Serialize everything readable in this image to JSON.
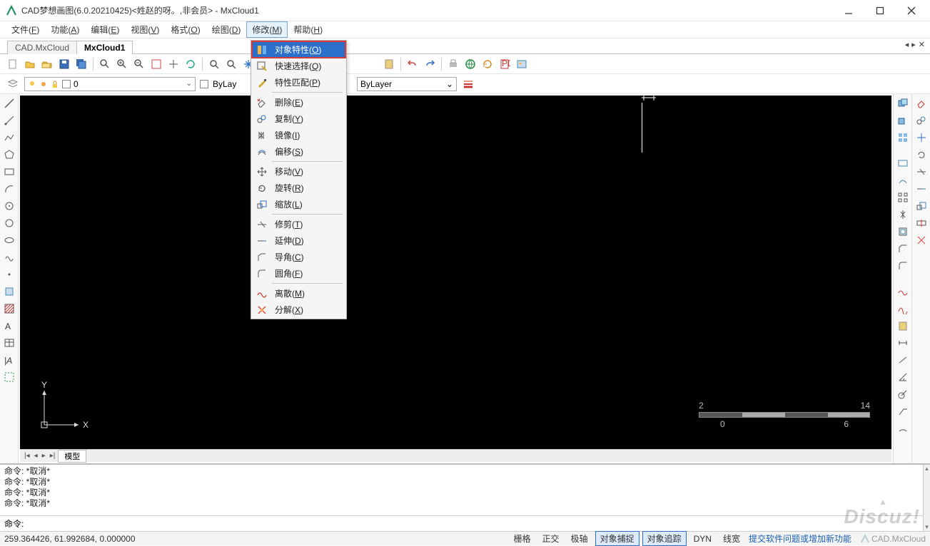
{
  "window": {
    "title": "CAD梦想画图(6.0.20210425)<姓赵的呀。,非会员> - MxCloud1"
  },
  "menubar": {
    "items": [
      {
        "label": "文件",
        "accel": "F"
      },
      {
        "label": "功能",
        "accel": "A"
      },
      {
        "label": "编辑",
        "accel": "E"
      },
      {
        "label": "视图",
        "accel": "V"
      },
      {
        "label": "格式",
        "accel": "O"
      },
      {
        "label": "绘图",
        "accel": "D"
      },
      {
        "label": "修改",
        "accel": "M",
        "open": true
      },
      {
        "label": "帮助",
        "accel": "H"
      }
    ]
  },
  "tabs": {
    "items": [
      {
        "label": "CAD.MxCloud",
        "active": false
      },
      {
        "label": "MxCloud1",
        "active": true
      }
    ]
  },
  "dropdown": {
    "items": [
      {
        "label": "对象特性",
        "accel": "O",
        "highlight": true,
        "icon": "properties-icon"
      },
      {
        "label": "快速选择",
        "accel": "Q",
        "icon": "quick-select-icon"
      },
      {
        "label": "特性匹配",
        "accel": "P",
        "icon": "match-props-icon"
      },
      {
        "sep": true
      },
      {
        "label": "删除",
        "accel": "E",
        "icon": "erase-icon"
      },
      {
        "label": "复制",
        "accel": "Y",
        "icon": "copy-icon"
      },
      {
        "label": "镜像",
        "accel": "I",
        "icon": "mirror-icon"
      },
      {
        "label": "偏移",
        "accel": "S",
        "icon": "offset-icon"
      },
      {
        "sep": true
      },
      {
        "label": "移动",
        "accel": "V",
        "icon": "move-icon"
      },
      {
        "label": "旋转",
        "accel": "R",
        "icon": "rotate-icon"
      },
      {
        "label": "缩放",
        "accel": "L",
        "icon": "scale-icon"
      },
      {
        "sep": true
      },
      {
        "label": "修剪",
        "accel": "T",
        "icon": "trim-icon"
      },
      {
        "label": "延伸",
        "accel": "D",
        "icon": "extend-icon"
      },
      {
        "label": "导角",
        "accel": "C",
        "icon": "chamfer-icon"
      },
      {
        "label": "圆角",
        "accel": "F",
        "icon": "fillet-icon"
      },
      {
        "sep": true
      },
      {
        "label": "离散",
        "accel": "M",
        "icon": "break-icon"
      },
      {
        "label": "分解",
        "accel": "X",
        "icon": "explode-icon"
      }
    ]
  },
  "layer": {
    "name": "0"
  },
  "linetype": {
    "label": "ByLayer",
    "label2": "ByLay"
  },
  "scale": {
    "t1": "2",
    "t2": "14",
    "b1": "0",
    "b2": "6"
  },
  "ucs": {
    "x": "X",
    "y": "Y"
  },
  "model_tab": "模型",
  "command": {
    "lines": [
      "命令:   *取消*",
      "命令:   *取消*",
      "命令:   *取消*",
      "命令:   *取消*"
    ],
    "prompt": "命令:"
  },
  "status": {
    "coords": "259.364426,  61.992684,  0.000000",
    "toggles": [
      {
        "label": "栅格",
        "on": false
      },
      {
        "label": "正交",
        "on": false
      },
      {
        "label": "极轴",
        "on": false
      },
      {
        "label": "对象捕捉",
        "on": true
      },
      {
        "label": "对象追踪",
        "on": true
      },
      {
        "label": "DYN",
        "on": false
      },
      {
        "label": "线宽",
        "on": false
      }
    ],
    "link": "提交软件问题或增加新功能",
    "brand": "CAD.MxCloud"
  },
  "watermark": "Discuz!"
}
